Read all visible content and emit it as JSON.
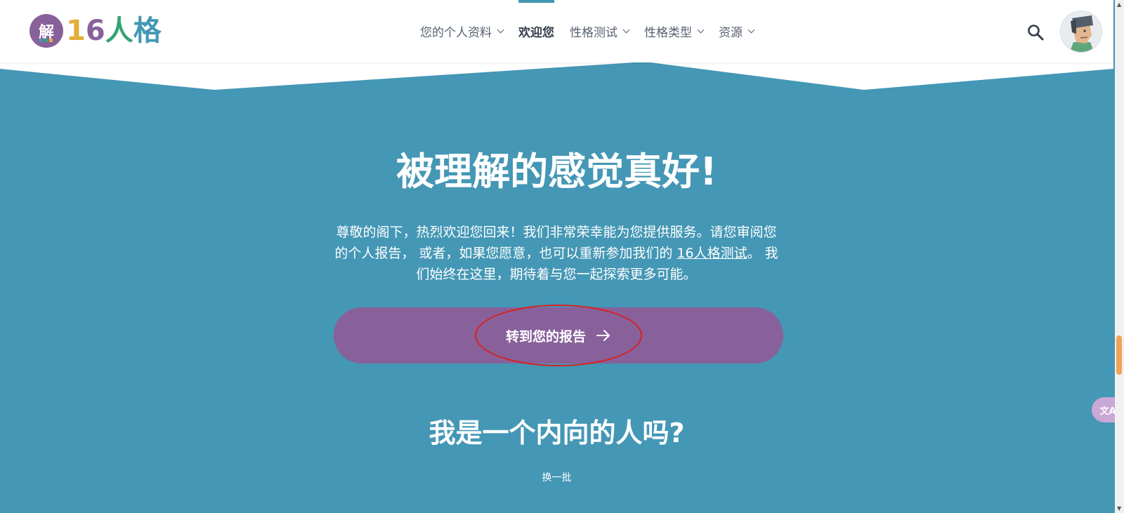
{
  "brand": {
    "logo_char": "解",
    "num1": "1",
    "num2": "6",
    "char1": "人",
    "char2": "格"
  },
  "nav": {
    "items": [
      {
        "label": "您的个人资料",
        "dropdown": true
      },
      {
        "label": "欢迎您",
        "dropdown": false,
        "active": true
      },
      {
        "label": "性格测试",
        "dropdown": true
      },
      {
        "label": "性格类型",
        "dropdown": true
      },
      {
        "label": "资源",
        "dropdown": true
      }
    ]
  },
  "hero": {
    "title": "被理解的感觉真好!",
    "intro_part1": "尊敬的阁下，热烈欢迎您回来！我们非常荣幸能为您提供服务。请您审阅您的个人报告， 或者，如果您愿意，也可以重新参加我们的 ",
    "intro_link": "16人格测试",
    "intro_part2": "。 我们始终在这里，期待着与您一起探索更多可能。",
    "cta_label": "转到您的报告",
    "subtitle": "我是一个内向的人吗?",
    "refresh_label": "换一批"
  },
  "translate_widget": {
    "label": "文A"
  },
  "colors": {
    "hero_bg": "#4497b5",
    "cta_bg": "#88619a",
    "annotation": "#d9201f",
    "scroll_thumb": "#f0a356",
    "active_tab": "#4298b4"
  },
  "icons": [
    "search-icon",
    "chevron-down-icon",
    "arrow-right-icon",
    "user-avatar",
    "translate-icon"
  ]
}
